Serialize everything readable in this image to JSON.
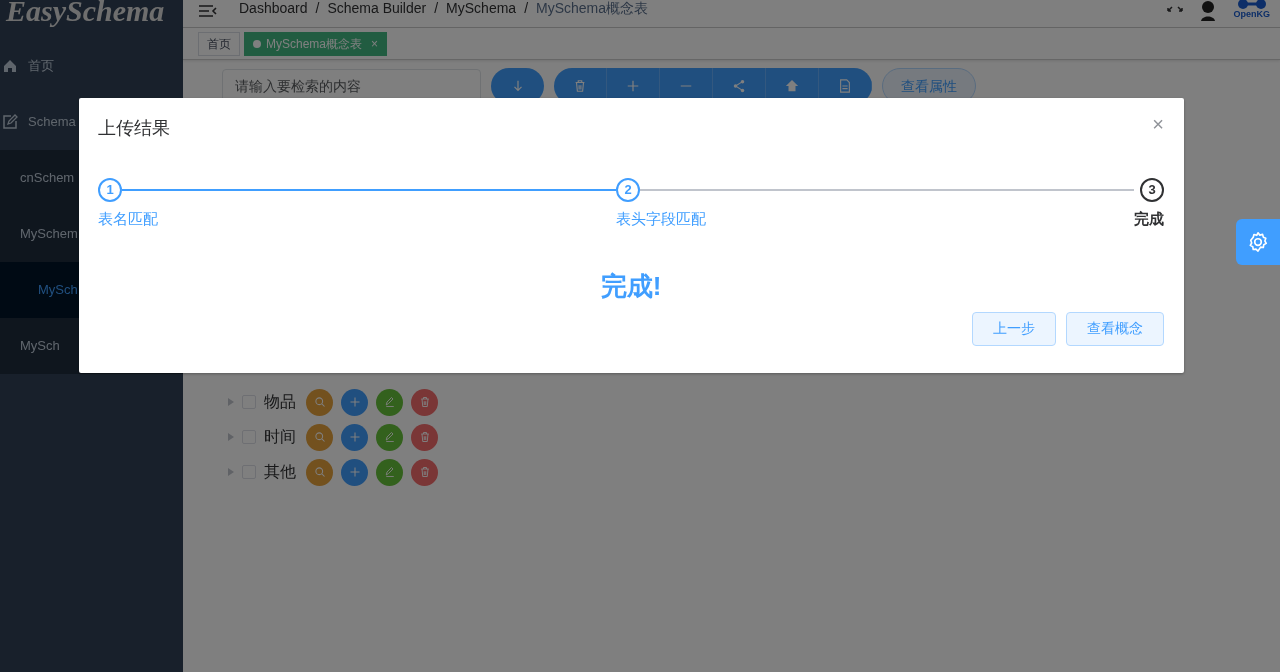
{
  "sidebar": {
    "logo": "EasySchema",
    "items": [
      {
        "label": "首页",
        "selected": false
      },
      {
        "label": "Schema",
        "selected": false,
        "children": [
          {
            "label": "cnSchem",
            "selected": false
          },
          {
            "label": "MySchem",
            "selected": false,
            "children": [
              {
                "label": "MySch",
                "selected": true
              }
            ]
          },
          {
            "label": "MySch",
            "selected": false
          }
        ]
      }
    ]
  },
  "header": {
    "breadcrumb": [
      {
        "label": "Dashboard",
        "current": false
      },
      {
        "separator": "/",
        "label": "Schema Builder",
        "current": false
      },
      {
        "separator": "/",
        "label": "MySchema",
        "current": false
      },
      {
        "separator": "/",
        "label": "MySchema概念表",
        "current": true
      }
    ],
    "logo_text": "OpenKG"
  },
  "tags": [
    {
      "label": "首页",
      "selected": false
    },
    {
      "label": "MySchema概念表",
      "selected": true,
      "close": "×"
    }
  ],
  "search": {
    "placeholder": "请输入要检索的内容"
  },
  "toolbar": {
    "properties_button": "查看属性"
  },
  "tree": [
    {
      "label": "物品",
      "checked": false
    },
    {
      "label": "时间",
      "checked": false
    },
    {
      "label": "其他",
      "checked": false
    }
  ],
  "dialog": {
    "title": "上传结果",
    "close": "×",
    "steps": [
      {
        "number": "1",
        "label": "表名匹配",
        "done": true
      },
      {
        "number": "2",
        "label": "表头字段匹配",
        "done": true
      },
      {
        "number": "3",
        "label": "完成",
        "done": false
      }
    ],
    "message": "完成!",
    "buttons": [
      "上一步",
      "查看概念"
    ]
  }
}
